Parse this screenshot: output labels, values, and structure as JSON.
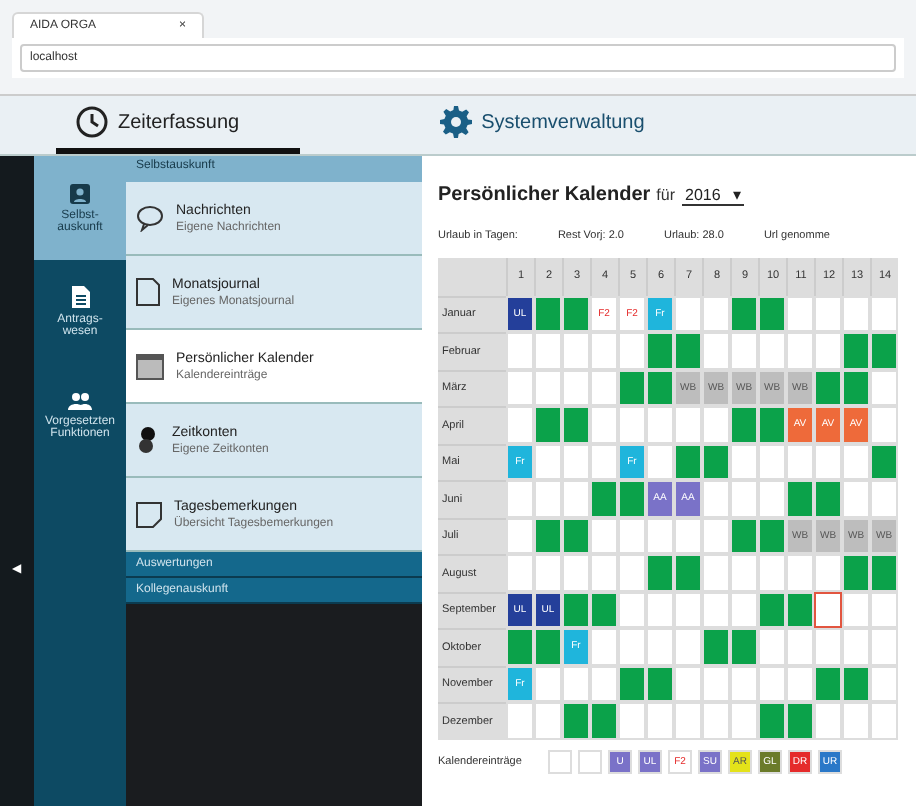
{
  "browser": {
    "tab_title": "AIDA ORGA",
    "tab_close": "×",
    "address": "localhost"
  },
  "app_tabs": [
    {
      "label": "Zeiterfassung",
      "selected": true
    },
    {
      "label": "Systemverwaltung",
      "selected": false
    }
  ],
  "rail": [
    {
      "label": "Selbst-auskunft",
      "selected": true
    },
    {
      "label": "Antrags-wesen",
      "selected": false
    },
    {
      "label": "Vorgesetzten Funktionen",
      "selected": false
    }
  ],
  "collapse": "◀",
  "menu": {
    "header": "Selbstauskunft",
    "items": [
      {
        "title": "Nachrichten",
        "subtitle": "Eigene Nachrichten",
        "selected": false
      },
      {
        "title": "Monatsjournal",
        "subtitle": "Eigenes Monatsjournal",
        "selected": false
      },
      {
        "title": "Persönlicher Kalender",
        "subtitle": "Kalendereinträge",
        "selected": true
      },
      {
        "title": "Zeitkonten",
        "subtitle": "Eigene Zeitkonten",
        "selected": false
      },
      {
        "title": "Tagesbemerkungen",
        "subtitle": "Übersicht Tagesbemerkungen",
        "selected": false
      }
    ],
    "sections": [
      "Auswertungen",
      "Kollegenauskunft"
    ]
  },
  "calendar": {
    "title": "Persönlicher Kalender",
    "for": "für",
    "year": "2016",
    "caret": "▾",
    "summary": [
      "Urlaub in Tagen:",
      "Rest Vorj: 2.0",
      "Urlaub: 28.0",
      "Url genomme"
    ],
    "days": [
      "1",
      "2",
      "3",
      "4",
      "5",
      "6",
      "7",
      "8",
      "9",
      "10",
      "11",
      "12",
      "13",
      "14"
    ],
    "months": [
      {
        "name": "Januar",
        "cells": [
          {
            "kind": "vacation",
            "text": "UL"
          },
          {
            "kind": "weekend"
          },
          {
            "kind": "weekend"
          },
          {
            "kind": "holiday",
            "text": "F2"
          },
          {
            "kind": "holiday",
            "text": "F2"
          },
          {
            "kind": "free",
            "text": "Fr"
          },
          {
            "kind": "empty"
          },
          {
            "kind": "empty"
          },
          {
            "kind": "weekend"
          },
          {
            "kind": "weekend"
          },
          {
            "kind": "empty"
          },
          {
            "kind": "empty"
          },
          {
            "kind": "empty"
          },
          {
            "kind": "empty"
          }
        ]
      },
      {
        "name": "Februar",
        "cells": [
          {
            "kind": "empty"
          },
          {
            "kind": "empty"
          },
          {
            "kind": "empty"
          },
          {
            "kind": "empty"
          },
          {
            "kind": "empty"
          },
          {
            "kind": "weekend"
          },
          {
            "kind": "weekend"
          },
          {
            "kind": "empty"
          },
          {
            "kind": "empty"
          },
          {
            "kind": "empty"
          },
          {
            "kind": "empty"
          },
          {
            "kind": "empty"
          },
          {
            "kind": "weekend"
          },
          {
            "kind": "weekend"
          }
        ]
      },
      {
        "name": "März",
        "cells": [
          {
            "kind": "empty"
          },
          {
            "kind": "empty"
          },
          {
            "kind": "empty"
          },
          {
            "kind": "empty"
          },
          {
            "kind": "weekend"
          },
          {
            "kind": "weekend"
          },
          {
            "kind": "training",
            "text": "WB"
          },
          {
            "kind": "training",
            "text": "WB"
          },
          {
            "kind": "training",
            "text": "WB"
          },
          {
            "kind": "training",
            "text": "WB"
          },
          {
            "kind": "training",
            "text": "WB"
          },
          {
            "kind": "weekend"
          },
          {
            "kind": "weekend"
          },
          {
            "kind": "empty"
          }
        ]
      },
      {
        "name": "April",
        "cells": [
          {
            "kind": "empty"
          },
          {
            "kind": "weekend"
          },
          {
            "kind": "weekend"
          },
          {
            "kind": "empty"
          },
          {
            "kind": "empty"
          },
          {
            "kind": "empty"
          },
          {
            "kind": "empty"
          },
          {
            "kind": "empty"
          },
          {
            "kind": "weekend"
          },
          {
            "kind": "weekend"
          },
          {
            "kind": "absence",
            "text": "AV"
          },
          {
            "kind": "absence",
            "text": "AV"
          },
          {
            "kind": "absence",
            "text": "AV"
          },
          {
            "kind": "empty"
          }
        ]
      },
      {
        "name": "Mai",
        "cells": [
          {
            "kind": "free",
            "text": "Fr"
          },
          {
            "kind": "empty"
          },
          {
            "kind": "empty"
          },
          {
            "kind": "empty"
          },
          {
            "kind": "free",
            "text": "Fr"
          },
          {
            "kind": "empty"
          },
          {
            "kind": "weekend"
          },
          {
            "kind": "weekend"
          },
          {
            "kind": "empty"
          },
          {
            "kind": "empty"
          },
          {
            "kind": "empty"
          },
          {
            "kind": "empty"
          },
          {
            "kind": "empty"
          },
          {
            "kind": "weekend"
          }
        ]
      },
      {
        "name": "Juni",
        "cells": [
          {
            "kind": "empty"
          },
          {
            "kind": "empty"
          },
          {
            "kind": "empty"
          },
          {
            "kind": "weekend"
          },
          {
            "kind": "weekend"
          },
          {
            "kind": "special",
            "text": "AA"
          },
          {
            "kind": "special",
            "text": "AA"
          },
          {
            "kind": "empty"
          },
          {
            "kind": "empty"
          },
          {
            "kind": "empty"
          },
          {
            "kind": "weekend"
          },
          {
            "kind": "weekend"
          },
          {
            "kind": "empty"
          },
          {
            "kind": "empty"
          }
        ]
      },
      {
        "name": "Juli",
        "cells": [
          {
            "kind": "empty"
          },
          {
            "kind": "weekend"
          },
          {
            "kind": "weekend"
          },
          {
            "kind": "empty"
          },
          {
            "kind": "empty"
          },
          {
            "kind": "empty"
          },
          {
            "kind": "empty"
          },
          {
            "kind": "empty"
          },
          {
            "kind": "weekend"
          },
          {
            "kind": "weekend"
          },
          {
            "kind": "training",
            "text": "WB"
          },
          {
            "kind": "training",
            "text": "WB"
          },
          {
            "kind": "training",
            "text": "WB"
          },
          {
            "kind": "training",
            "text": "WB"
          }
        ]
      },
      {
        "name": "August",
        "cells": [
          {
            "kind": "empty"
          },
          {
            "kind": "empty"
          },
          {
            "kind": "empty"
          },
          {
            "kind": "empty"
          },
          {
            "kind": "empty"
          },
          {
            "kind": "weekend"
          },
          {
            "kind": "weekend"
          },
          {
            "kind": "empty"
          },
          {
            "kind": "empty"
          },
          {
            "kind": "empty"
          },
          {
            "kind": "empty"
          },
          {
            "kind": "empty"
          },
          {
            "kind": "weekend"
          },
          {
            "kind": "weekend"
          }
        ]
      },
      {
        "name": "September",
        "cells": [
          {
            "kind": "vacation",
            "text": "UL"
          },
          {
            "kind": "vacation",
            "text": "UL"
          },
          {
            "kind": "weekend"
          },
          {
            "kind": "weekend"
          },
          {
            "kind": "empty"
          },
          {
            "kind": "empty"
          },
          {
            "kind": "empty"
          },
          {
            "kind": "empty"
          },
          {
            "kind": "empty"
          },
          {
            "kind": "weekend"
          },
          {
            "kind": "weekend"
          },
          {
            "kind": "today"
          },
          {
            "kind": "empty"
          },
          {
            "kind": "empty"
          }
        ]
      },
      {
        "name": "Oktober",
        "cells": [
          {
            "kind": "weekend"
          },
          {
            "kind": "weekend"
          },
          {
            "kind": "free",
            "text": "Fr"
          },
          {
            "kind": "empty"
          },
          {
            "kind": "empty"
          },
          {
            "kind": "empty"
          },
          {
            "kind": "empty"
          },
          {
            "kind": "weekend"
          },
          {
            "kind": "weekend"
          },
          {
            "kind": "empty"
          },
          {
            "kind": "empty"
          },
          {
            "kind": "empty"
          },
          {
            "kind": "empty"
          },
          {
            "kind": "empty"
          }
        ]
      },
      {
        "name": "November",
        "cells": [
          {
            "kind": "free",
            "text": "Fr"
          },
          {
            "kind": "empty"
          },
          {
            "kind": "empty"
          },
          {
            "kind": "empty"
          },
          {
            "kind": "weekend"
          },
          {
            "kind": "weekend"
          },
          {
            "kind": "empty"
          },
          {
            "kind": "empty"
          },
          {
            "kind": "empty"
          },
          {
            "kind": "empty"
          },
          {
            "kind": "empty"
          },
          {
            "kind": "weekend"
          },
          {
            "kind": "weekend"
          },
          {
            "kind": "empty"
          }
        ]
      },
      {
        "name": "Dezember",
        "cells": [
          {
            "kind": "empty"
          },
          {
            "kind": "empty"
          },
          {
            "kind": "weekend"
          },
          {
            "kind": "weekend"
          },
          {
            "kind": "empty"
          },
          {
            "kind": "empty"
          },
          {
            "kind": "empty"
          },
          {
            "kind": "empty"
          },
          {
            "kind": "empty"
          },
          {
            "kind": "weekend"
          },
          {
            "kind": "weekend"
          },
          {
            "kind": "empty"
          },
          {
            "kind": "empty"
          },
          {
            "kind": "empty"
          }
        ]
      }
    ],
    "legend_label": "Kalendereinträge",
    "legend": [
      {
        "kind": "empty"
      },
      {
        "kind": "empty"
      },
      {
        "kind": "special",
        "text": "U"
      },
      {
        "kind": "special",
        "text": "UL"
      },
      {
        "kind": "holiday",
        "text": "F2"
      },
      {
        "kind": "special",
        "text": "SU"
      },
      {
        "kind": "yellow",
        "text": "AR"
      },
      {
        "kind": "olive",
        "text": "GL"
      },
      {
        "kind": "red",
        "text": "DR"
      },
      {
        "kind": "blue",
        "text": "UR"
      }
    ]
  }
}
